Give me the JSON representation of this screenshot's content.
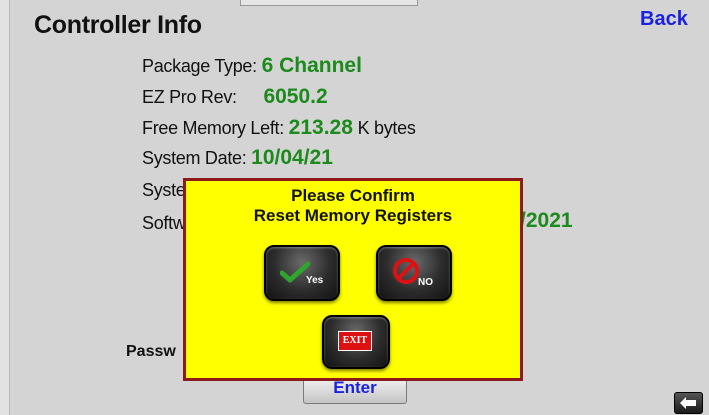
{
  "screen": {
    "title": "Controller Info",
    "back_label": "Back",
    "rows": {
      "package_type": {
        "label": "Package Type:",
        "value": "6 Channel"
      },
      "ez_pro_rev": {
        "label": "EZ Pro Rev:",
        "value": "6050.2"
      },
      "free_memory": {
        "label": "Free Memory Left:",
        "value": "213.28",
        "unit": "K bytes"
      },
      "system_date": {
        "label": "System Date:",
        "value": "10/04/21"
      },
      "system_partial": {
        "label": "Syste"
      },
      "software_partial": {
        "label": "Softw",
        "value_partial": "/2021"
      }
    },
    "password_label": "Passw",
    "enter_label": "Enter"
  },
  "dialog": {
    "title_line1": "Please Confirm",
    "title_line2": "Reset Memory Registers",
    "yes_label": "Yes",
    "no_label": "NO",
    "exit_label": "EXIT"
  },
  "colors": {
    "value_green": "#1c8a1c",
    "link_blue": "#1a22e0",
    "dialog_bg": "#ffff00",
    "dialog_border": "#8c1a1a"
  },
  "icons": [
    "checkmark-icon",
    "no-sign-icon",
    "exit-icon",
    "back-arrow-icon"
  ]
}
